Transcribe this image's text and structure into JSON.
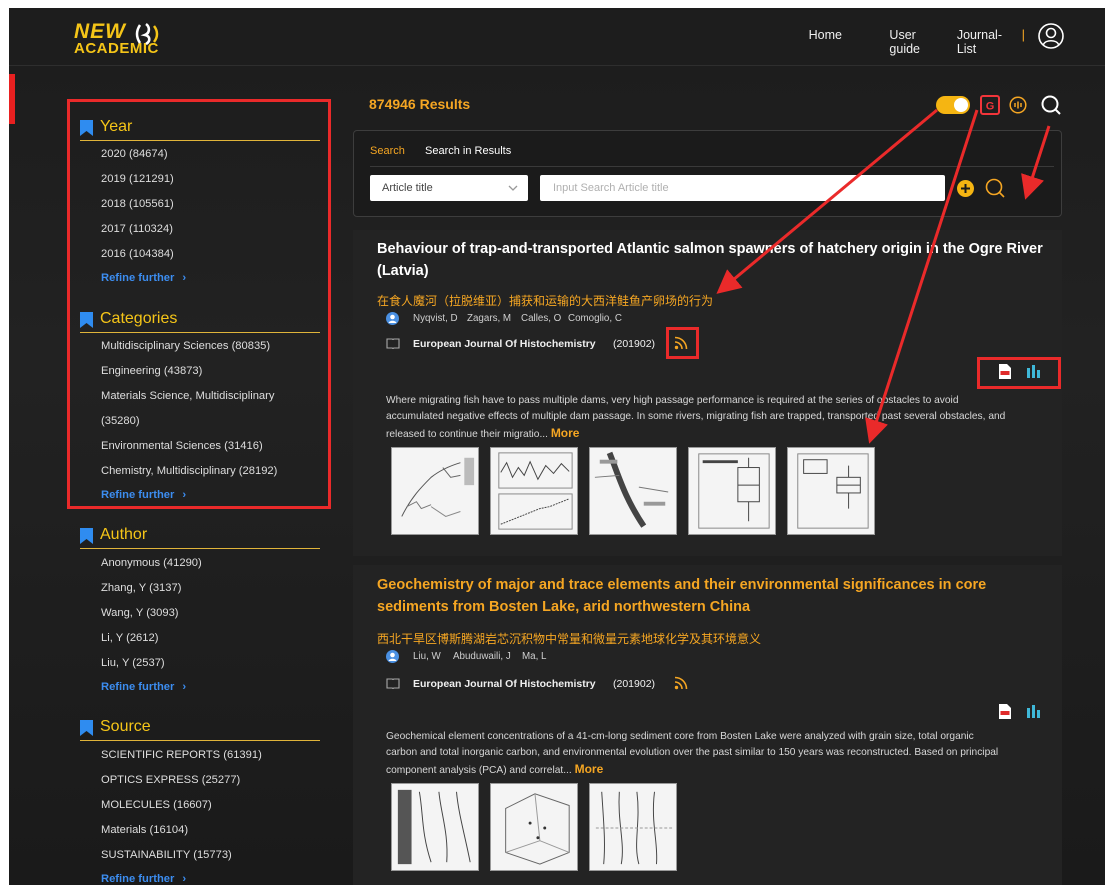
{
  "header": {
    "logo_top": "NEW",
    "logo_bottom": "ACADEMIC",
    "nav": [
      "Home",
      "User guide",
      "Journal-List"
    ],
    "separator": "|"
  },
  "sidebar": {
    "facets": [
      {
        "title": "Year",
        "items": [
          "2020 (84674)",
          "2019 (121291)",
          "2018 (105561)",
          "2017 (110324)",
          "2016 (104384)"
        ],
        "refine": "Refine further"
      },
      {
        "title": "Categories",
        "items": [
          "Multidisciplinary Sciences (80835)",
          "Engineering (43873)",
          "Materials Science, Multidisciplinary",
          "(35280)",
          "Environmental Sciences (31416)",
          "Chemistry, Multidisciplinary (28192)"
        ],
        "refine": "Refine further"
      },
      {
        "title": "Author",
        "items": [
          "Anonymous (41290)",
          "Zhang, Y (3137)",
          "Wang, Y (3093)",
          "Li, Y (2612)",
          "Liu, Y (2537)"
        ],
        "refine": "Refine further"
      },
      {
        "title": "Source",
        "items": [
          "SCIENTIFIC REPORTS (61391)",
          "OPTICS EXPRESS (25277)",
          "MOLECULES (16607)",
          "Materials (16104)",
          "SUSTAINABILITY (15773)"
        ],
        "refine": "Refine further"
      }
    ]
  },
  "main": {
    "results_count": "874946 Results",
    "search": {
      "tab_search": "Search",
      "tab_results": "Search in Results",
      "field_select": "Article title",
      "placeholder": "Input Search Article title"
    },
    "articles": [
      {
        "title_line1": "Behaviour of trap-and-transported Atlantic salmon spawners of hatchery origin in the Ogre River",
        "title_line2": "(Latvia)",
        "title_color": "#ffffff",
        "title_zh": "在食人魔河（拉脱维亚）捕获和运输的大西洋鲑鱼产卵场的行为",
        "authors": [
          "Nyqvist, D",
          "Zagars, M",
          "Calles, O",
          "Comoglio, C"
        ],
        "journal": "European Journal Of Histochemistry",
        "date": "(201902)",
        "abstract_lines": [
          "Where migrating fish have to pass multiple dams, very high passage performance is required at the series of obstacles to avoid",
          "accumulated negative effects of multiple dam passage. In some rivers, migrating fish are trapped, transported past several obstacles, and",
          "released to continue their migratio..."
        ],
        "more": "More"
      },
      {
        "title_line1": "Geochemistry of major and trace elements and their environmental significances in core",
        "title_line2": "sediments from Bosten Lake, arid northwestern China",
        "title_color": "#f5a623",
        "title_zh": "西北干旱区博斯腾湖岩芯沉积物中常量和微量元素地球化学及其环境意义",
        "authors": [
          "Liu, W",
          "Abuduwaili, J",
          "Ma, L"
        ],
        "journal": "European Journal Of Histochemistry",
        "date": "(201902)",
        "abstract_lines": [
          "Geochemical element concentrations of a 41-cm-long sediment core from Bosten Lake were analyzed with grain size, total organic",
          "carbon and total inorganic carbon, and environmental evolution over the past similar to 150 years was reconstructed. Based on principal",
          "component analysis (PCA) and correlat..."
        ],
        "more": "More"
      }
    ]
  },
  "colors": {
    "accent": "#f5a623",
    "highlight": "#f5c518",
    "link": "#3c8df0",
    "annotation_red": "#ea2a2a"
  },
  "icons": [
    "user-icon",
    "bookmark-icon",
    "chevron-right-icon",
    "toggle-switch",
    "g-badge-icon",
    "sound-icon",
    "search-icon",
    "plus-icon",
    "chevron-down-icon",
    "author-icon",
    "book-icon",
    "rss-icon",
    "pdf-icon",
    "chart-icon"
  ]
}
